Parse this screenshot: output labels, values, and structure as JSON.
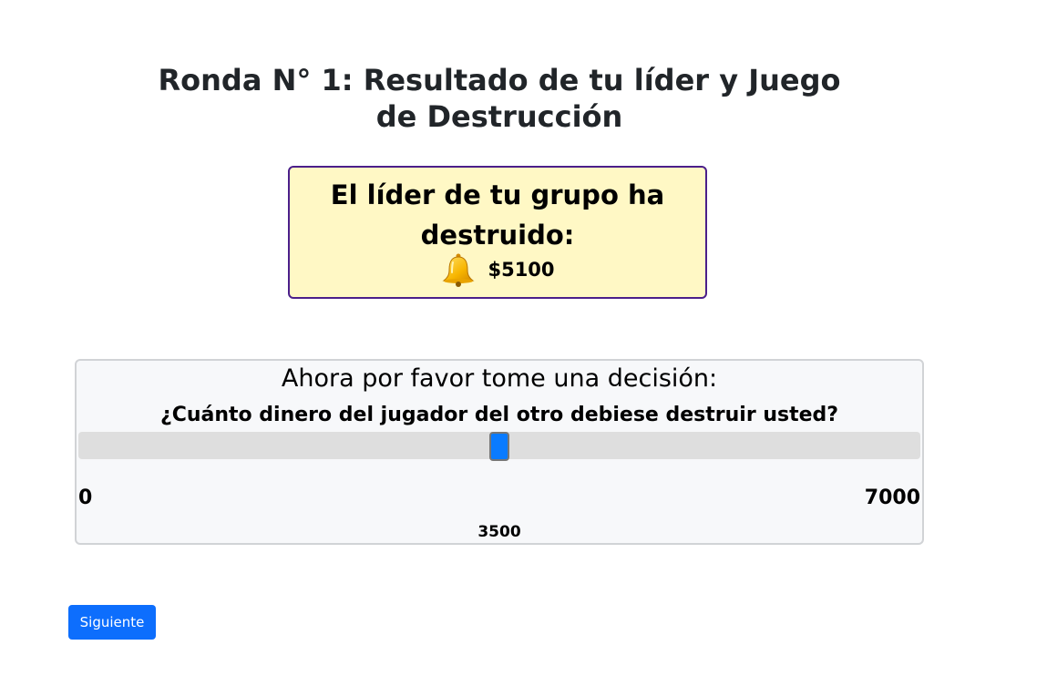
{
  "page": {
    "title": "Ronda N° 1: Resultado de tu líder y Juego de Destrucción"
  },
  "leader_result": {
    "text": "El líder de tu grupo ha destruido:",
    "icon": "bell-icon",
    "amount": "$5100",
    "colors": {
      "background": "#fff8c5",
      "border": "#4b1f8a"
    }
  },
  "decision": {
    "prompt": "Ahora por favor tome una decisión:",
    "question": "¿Cuánto dinero del jugador del otro debiese destruir usted?",
    "slider": {
      "min": 0,
      "max": 7000,
      "value": 3500,
      "min_label": "0",
      "max_label": "7000",
      "value_label": "3500",
      "thumb_color": "#0a7bff"
    }
  },
  "actions": {
    "next_label": "Siguiente",
    "next_color": "#0d6efd"
  }
}
